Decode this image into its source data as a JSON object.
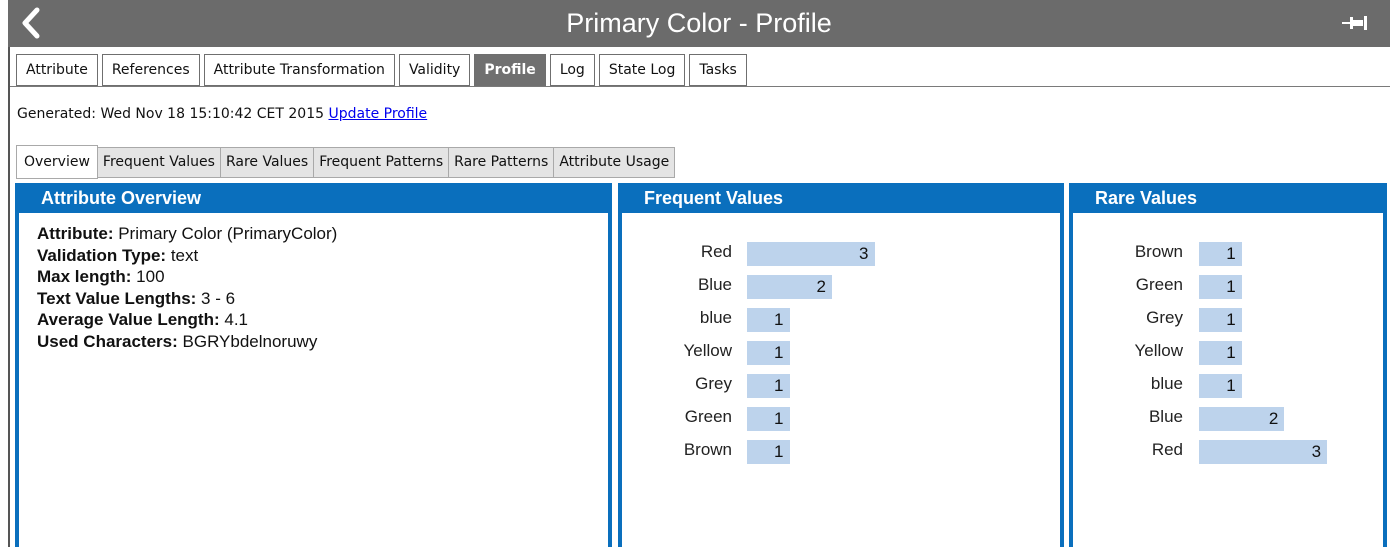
{
  "window": {
    "title": "Primary Color - Profile"
  },
  "main_tabs": [
    {
      "label": "Attribute",
      "active": false
    },
    {
      "label": "References",
      "active": false
    },
    {
      "label": "Attribute Transformation",
      "active": false
    },
    {
      "label": "Validity",
      "active": false
    },
    {
      "label": "Profile",
      "active": true
    },
    {
      "label": "Log",
      "active": false
    },
    {
      "label": "State Log",
      "active": false
    },
    {
      "label": "Tasks",
      "active": false
    }
  ],
  "generated": {
    "text": "Generated: Wed Nov 18 15:10:42 CET 2015",
    "link": "Update Profile"
  },
  "sub_tabs": [
    {
      "label": "Overview",
      "active": true
    },
    {
      "label": "Frequent Values",
      "active": false
    },
    {
      "label": "Rare Values",
      "active": false
    },
    {
      "label": "Frequent Patterns",
      "active": false
    },
    {
      "label": "Rare Patterns",
      "active": false
    },
    {
      "label": "Attribute Usage",
      "active": false
    }
  ],
  "overview": {
    "header": "Attribute Overview",
    "rows": [
      {
        "label": "Attribute:",
        "value": " Primary Color (PrimaryColor)"
      },
      {
        "label": "Validation Type:",
        "value": " text"
      },
      {
        "label": "Max length:",
        "value": " 100"
      },
      {
        "label": "Text Value Lengths:",
        "value": " 3 - 6"
      },
      {
        "label": "Average Value Length:",
        "value": " 4.1"
      },
      {
        "label": "Used Characters:",
        "value": " BGRYbdelnoruwy"
      }
    ]
  },
  "frequent": {
    "header": "Frequent Values",
    "items": [
      {
        "label": "Red",
        "value": 3
      },
      {
        "label": "Blue",
        "value": 2
      },
      {
        "label": "blue",
        "value": 1
      },
      {
        "label": "Yellow",
        "value": 1
      },
      {
        "label": "Grey",
        "value": 1
      },
      {
        "label": "Green",
        "value": 1
      },
      {
        "label": "Brown",
        "value": 1
      }
    ]
  },
  "rare": {
    "header": "Rare Values",
    "items": [
      {
        "label": "Brown",
        "value": 1
      },
      {
        "label": "Green",
        "value": 1
      },
      {
        "label": "Grey",
        "value": 1
      },
      {
        "label": "Yellow",
        "value": 1
      },
      {
        "label": "blue",
        "value": 1
      },
      {
        "label": "Blue",
        "value": 2
      },
      {
        "label": "Red",
        "value": 3
      }
    ]
  },
  "colors": {
    "panel_blue": "#0a6fbd",
    "bar_fill": "#bdd3ec",
    "title_bar": "#6b6b6b",
    "link": "#0000ee"
  },
  "icons": {
    "back": "chevron-left-icon",
    "pin": "pin-icon"
  }
}
